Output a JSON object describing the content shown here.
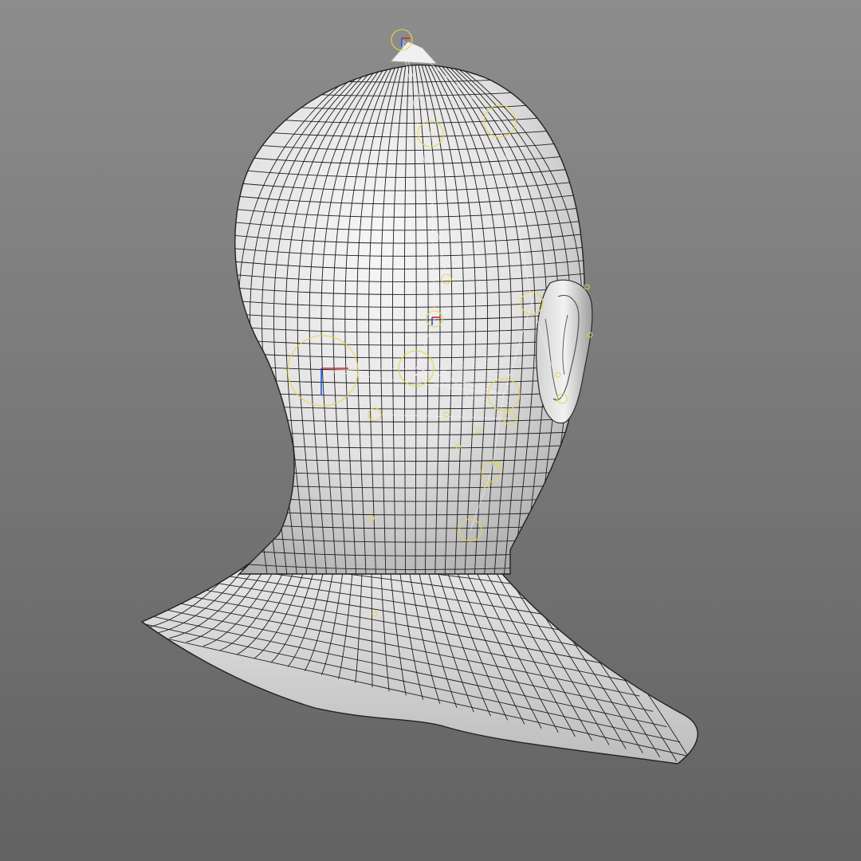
{
  "viewport": {
    "background_top": "#8d8d8d",
    "background_bottom": "#626262",
    "mesh_fill": "#ececec",
    "mesh_shade": "#b9b9b9",
    "wire_color": "#1e1e1e",
    "rig_color": "#e8d54a",
    "rig_line_color": "#f4f4f4",
    "axis_x_color": "#e02020",
    "axis_y_color": "#2050e0"
  },
  "model": {
    "subject": "head-bust-wireframe",
    "rig_controls": 14
  }
}
